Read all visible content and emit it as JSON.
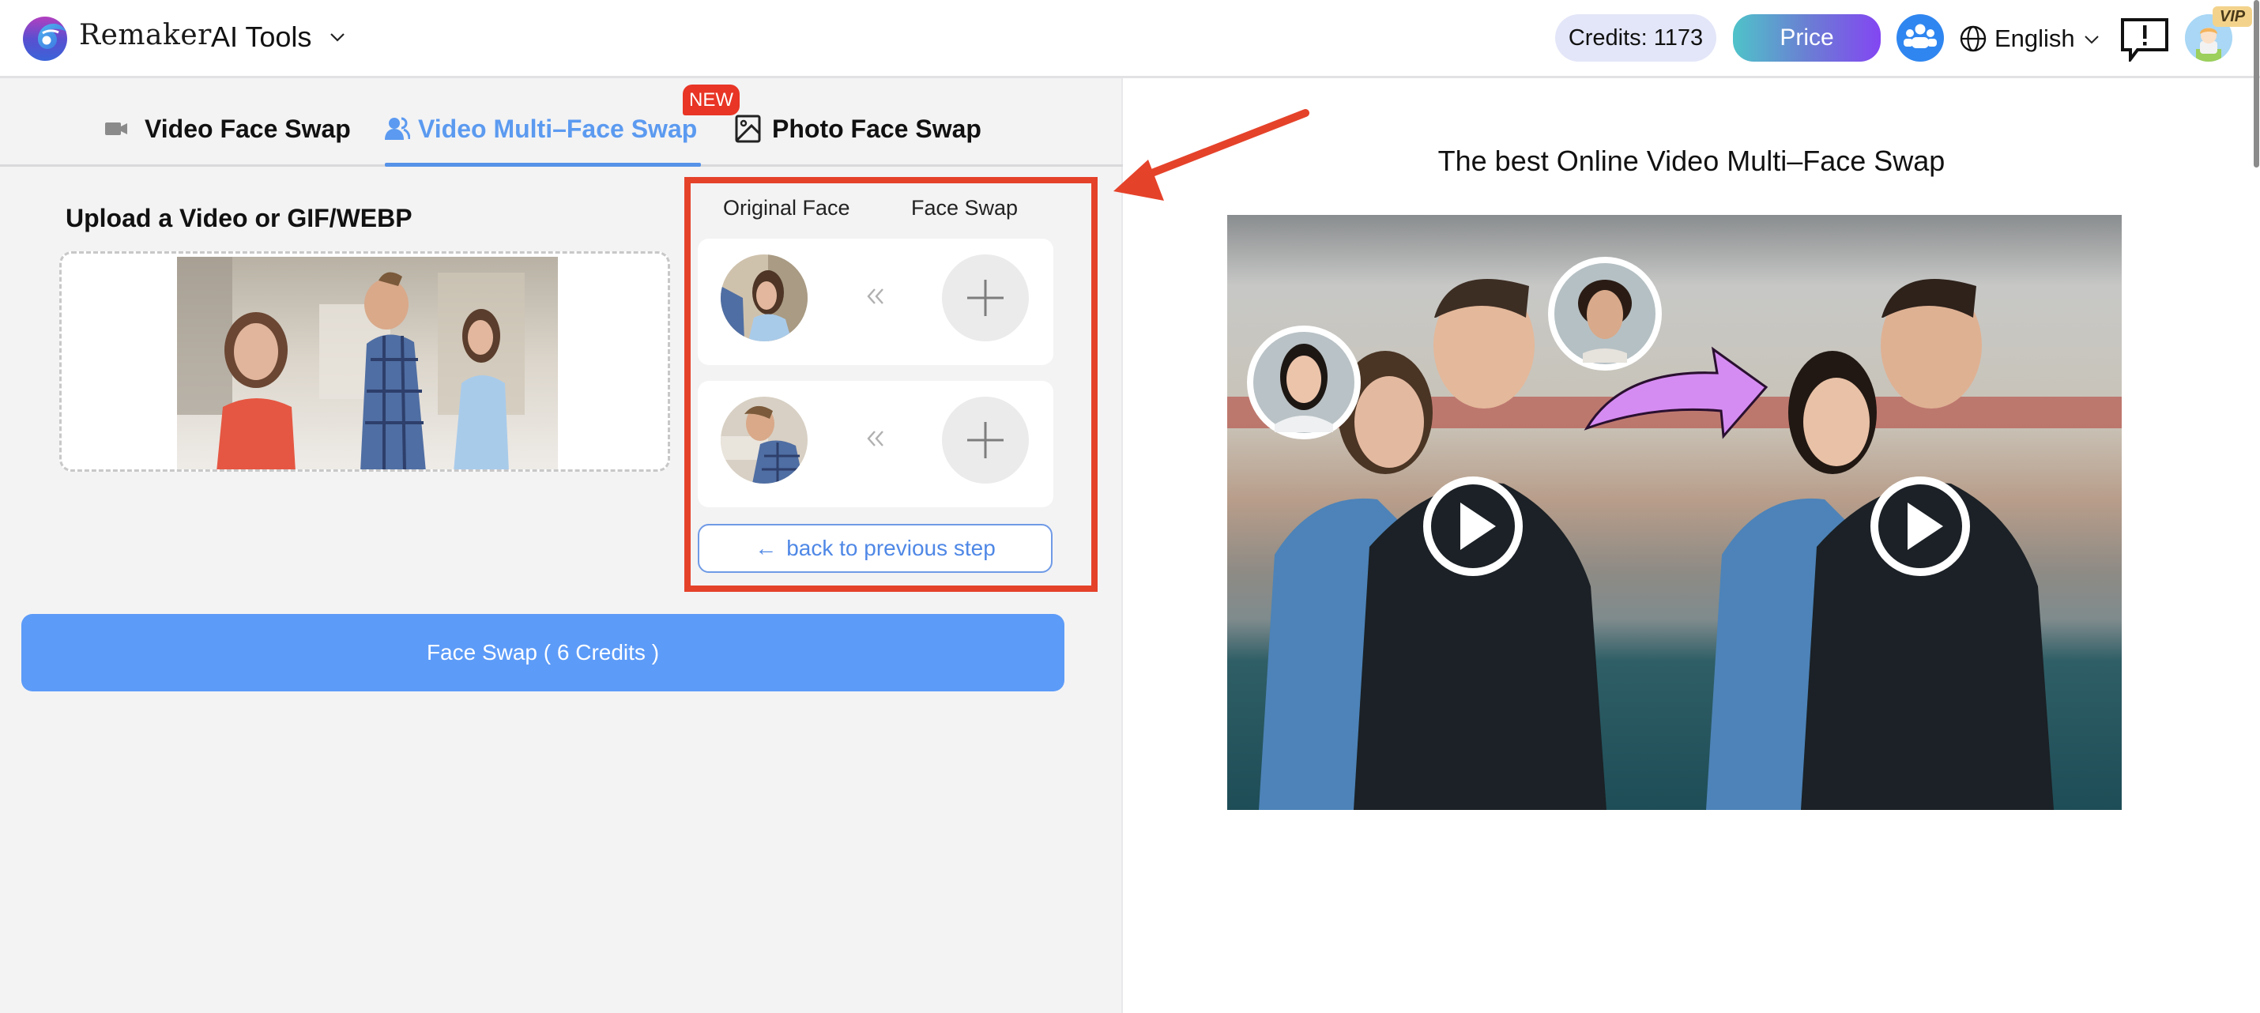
{
  "header": {
    "brand": "Remaker",
    "ai_tools_label": "AI Tools",
    "credits_label": "Credits: 1173",
    "price_label": "Price",
    "language": "English",
    "vip_badge": "VIP",
    "icons": [
      "remaker-logo",
      "chevron-down-icon",
      "community-icon",
      "globe-icon",
      "feedback-icon",
      "user-avatar"
    ]
  },
  "tabs": [
    {
      "label": "Video Face Swap",
      "icon": "video-camera-icon",
      "active": false
    },
    {
      "label": "Video Multi–Face Swap",
      "icon": "users-icon",
      "active": true,
      "badge": "NEW"
    },
    {
      "label": "Photo Face Swap",
      "icon": "image-icon",
      "active": false
    }
  ],
  "upload": {
    "title": "Upload a Video or GIF/WEBP",
    "preview": "uploaded video thumbnail (three people on street)"
  },
  "face_mapping": {
    "col_original": "Original Face",
    "col_swap": "Face Swap",
    "rows": [
      {
        "original": "woman in light blue top",
        "swap_target": "empty"
      },
      {
        "original": "man in plaid shirt",
        "swap_target": "empty"
      }
    ],
    "back_label": "back to previous step",
    "back_icon": "←"
  },
  "action": {
    "faceswap_label": "Face Swap ( 6 Credits )"
  },
  "demo": {
    "title": "The best Online Video Multi–Face Swap"
  },
  "colors": {
    "accent_blue": "#5c9bf8",
    "active_tab": "#5b9af0",
    "highlight_red": "#e5422a",
    "new_badge": "#e83525"
  }
}
